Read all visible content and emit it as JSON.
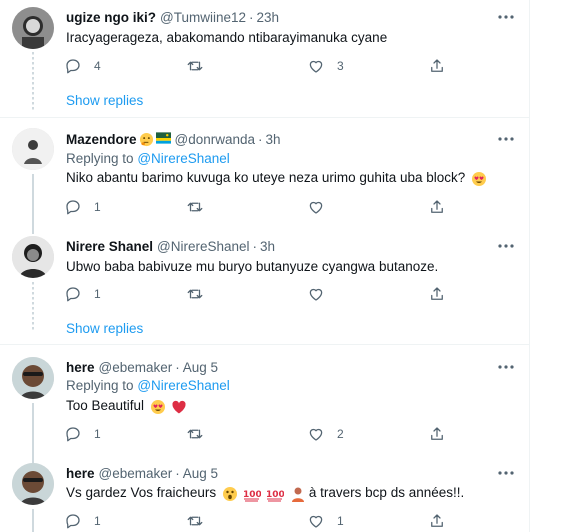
{
  "tweets": [
    {
      "name": "ugize ngo iki?",
      "handle": "@Tumwiine12",
      "time": "23h",
      "text": "Iracyagerageza, abakomando ntibarayimanuka cyane",
      "reply_count": "4",
      "retweet_count": "",
      "like_count": "3"
    },
    {
      "name": "Mazendore",
      "name_emojis": [
        "thinking-face",
        "rwanda-flag"
      ],
      "handle": "@donrwanda",
      "time": "3h",
      "replying_label": "Replying to",
      "replying_to": "@NirereShanel",
      "text": "Niko abantu barimo kuvuga ko uteye neza urimo guhita uba block?",
      "reply_count": "1",
      "retweet_count": "",
      "like_count": ""
    },
    {
      "name": "Nirere Shanel",
      "handle": "@NirereShanel",
      "time": "3h",
      "text": "Ubwo baba babivuze mu buryo butanyuze cyangwa butanoze.",
      "reply_count": "1",
      "retweet_count": "",
      "like_count": ""
    },
    {
      "name": "here",
      "handle": "@ebemaker",
      "time": "Aug 5",
      "replying_label": "Replying to",
      "replying_to": "@NirereShanel",
      "text": "Too Beautiful",
      "reply_count": "1",
      "retweet_count": "",
      "like_count": "2"
    },
    {
      "name": "here",
      "handle": "@ebemaker",
      "time": "Aug 5",
      "text_before": "Vs gardez Vos fraicheurs",
      "text_after": "à travers bcp ds années!!.",
      "reply_count": "1",
      "retweet_count": "",
      "like_count": "1"
    }
  ],
  "show_replies_label": "Show replies",
  "dot": "·",
  "colors": {
    "accent": "#1d9bf0",
    "secondary_text": "#536471",
    "primary_text": "#0f1419",
    "divider": "#eff3f4",
    "thread_line": "#cfd9de",
    "heart_red": "#e0245e"
  },
  "icons": [
    "reply-icon",
    "retweet-icon",
    "like-icon",
    "share-icon",
    "more-icon"
  ]
}
